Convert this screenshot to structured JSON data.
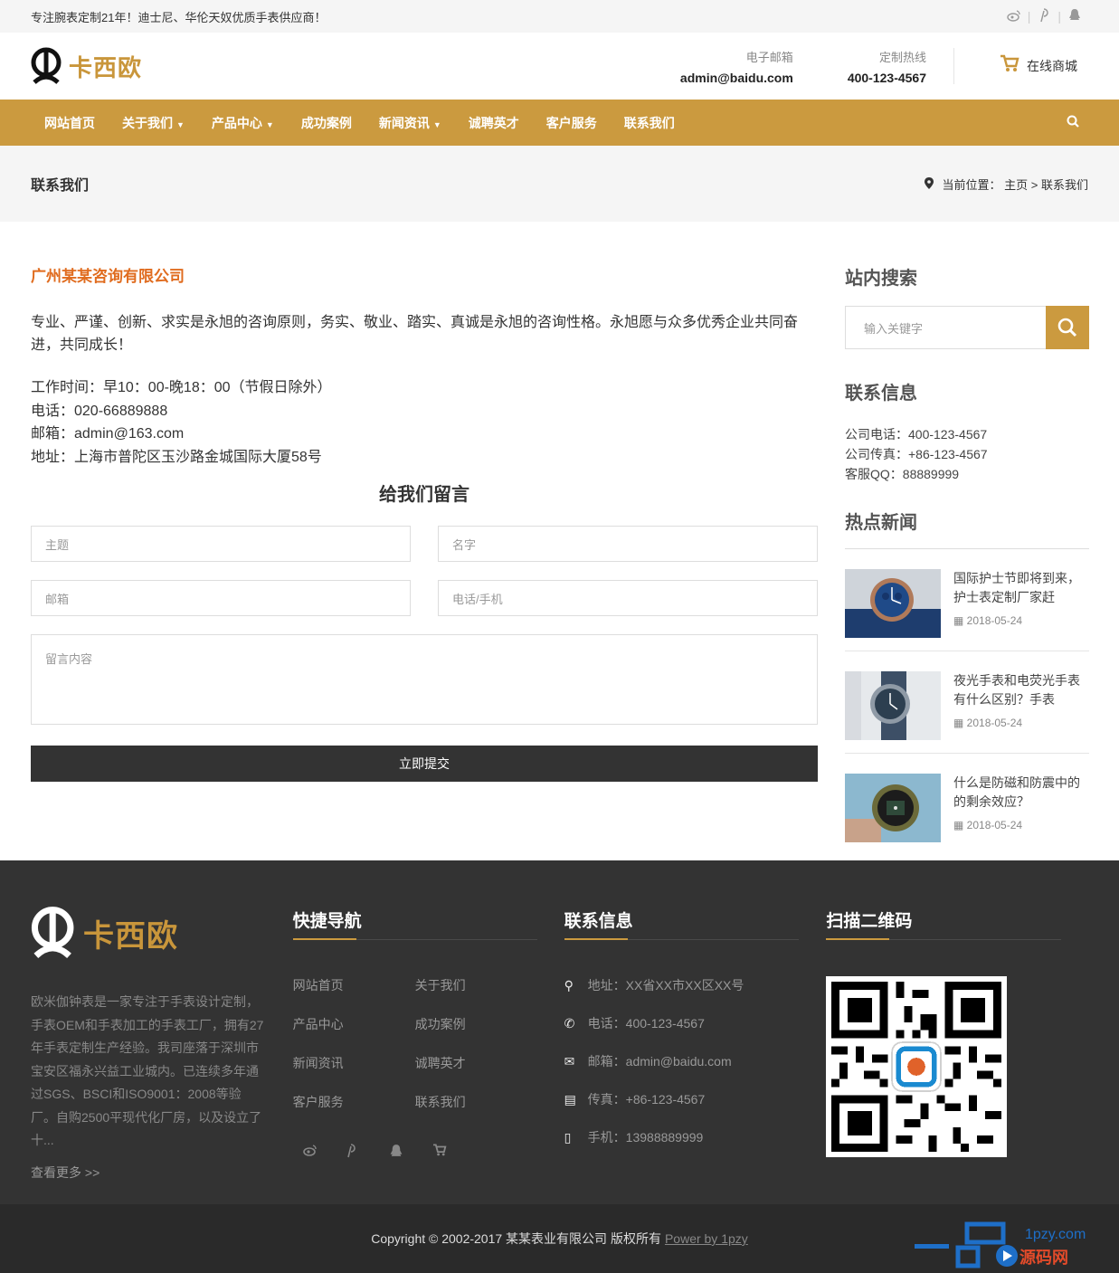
{
  "topbar": {
    "slogan": "专注腕表定制21年！迪士尼、华伦天奴优质手表供应商！"
  },
  "header": {
    "logo_text": "卡西欧",
    "email_label": "电子邮箱",
    "email_value": "admin@baidu.com",
    "hotline_label": "定制热线",
    "hotline_value": "400-123-4567",
    "shop_label": "在线商城"
  },
  "nav": {
    "items": [
      "网站首页",
      "关于我们",
      "产品中心",
      "成功案例",
      "新闻资讯",
      "诚聘英才",
      "客户服务",
      "联系我们"
    ]
  },
  "crumbbar": {
    "title": "联系我们",
    "prefix": "当前位置：",
    "home": "主页",
    "sep": ">",
    "current": "联系我们"
  },
  "content": {
    "company": "广州某某咨询有限公司",
    "intro": "专业、严谨、创新、求实是永旭的咨询原则，务实、敬业、踏实、真诚是永旭的咨询性格。永旭愿与众多优秀企业共同奋进，共同成长！",
    "hours": "工作时间：早10：00-晚18：00（节假日除外）",
    "phone": "电话：020-66889888",
    "email": "邮箱：admin@163.com",
    "address": "地址：上海市普陀区玉沙路金城国际大厦58号"
  },
  "form": {
    "title": "给我们留言",
    "subject_placeholder": "主题",
    "name_placeholder": "名字",
    "email_placeholder": "邮箱",
    "phone_placeholder": "电话/手机",
    "message_placeholder": "留言内容",
    "submit_label": "立即提交"
  },
  "sidebar": {
    "search_title": "站内搜索",
    "search_placeholder": "输入关键字",
    "contact_title": "联系信息",
    "contact_phone": "公司电话：400-123-4567",
    "contact_fax": "公司传真：+86-123-4567",
    "contact_qq": "客服QQ：88889999",
    "news_title": "热点新闻",
    "news": [
      {
        "title": "国际护士节即将到来，护士表定制厂家赶",
        "date": "2018-05-24"
      },
      {
        "title": "夜光手表和电荧光手表有什么区别？手表",
        "date": "2018-05-24"
      },
      {
        "title": "什么是防磁和防震中的的剩余效应？",
        "date": "2018-05-24"
      }
    ]
  },
  "footer": {
    "logo_text": "卡西欧",
    "desc": "欧米伽钟表是一家专注于手表设计定制，手表OEM和手表加工的手表工厂，拥有27年手表定制生产经验。我司座落于深圳市宝安区福永兴益工业城内。已连续多年通过SGS、BSCI和ISO9001：2008等验厂。自购2500平现代化厂房，以及设立了十...",
    "more": "查看更多 >>",
    "nav_title": "快捷导航",
    "nav_items": [
      "网站首页",
      "关于我们",
      "产品中心",
      "成功案例",
      "新闻资讯",
      "诚聘英才",
      "客户服务",
      "联系我们"
    ],
    "contact_title": "联系信息",
    "address": "地址：XX省XX市XX区XX号",
    "phone": "电话：400-123-4567",
    "email": "邮箱：admin@baidu.com",
    "fax": "传真：+86-123-4567",
    "mobile": "手机：13988889999",
    "qr_title": "扫描二维码"
  },
  "copyright": {
    "text": "Copyright © 2002-2017 某某表业有限公司 版权所有",
    "power": "Power by 1pzy"
  },
  "watermark": {
    "text": "1pzy.com"
  },
  "colors": {
    "accent": "#cb9a3f",
    "orange_title": "#e06c1f",
    "footer_bg": "#333333"
  }
}
